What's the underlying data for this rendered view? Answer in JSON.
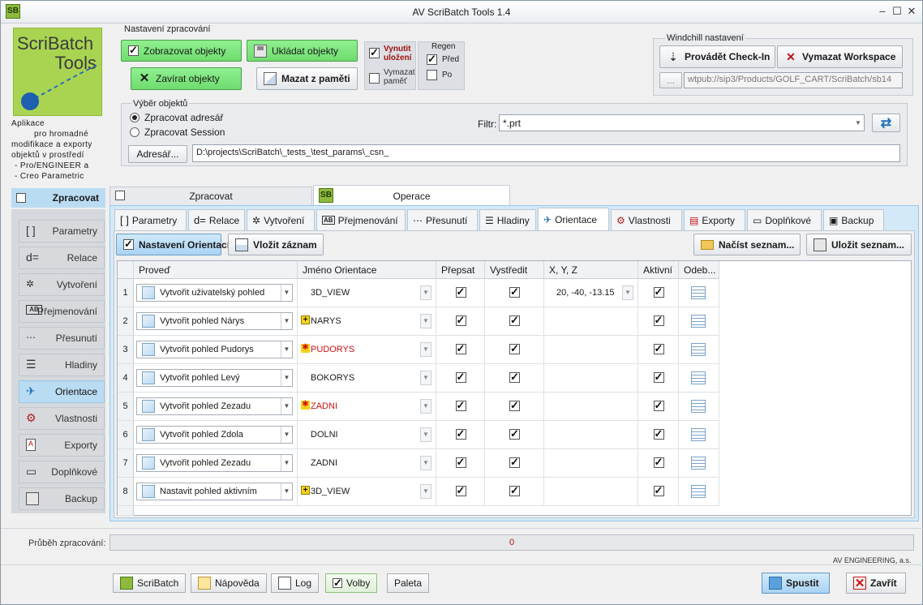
{
  "window": {
    "title": "AV ScriBatch Tools 1.4",
    "app_badge": "SB"
  },
  "logo": {
    "line1": "ScriBatch",
    "line2": "Tools"
  },
  "about": {
    "line1": "Aplikace",
    "line2": "pro hromadné",
    "line3": "modifikace a exporty",
    "line4": "objektů v prostředí",
    "line5": "- Pro/ENGINEER a",
    "line6": "- Creo Parametric"
  },
  "processing_settings": {
    "label": "Nastavení zpracování",
    "show_objects": "Zobrazovat objekty",
    "save_objects": "Ukládat objekty",
    "close_objects": "Zavírat objekty",
    "clear_memory": "Mazat z paměti",
    "force_save_line1": "Vynutit",
    "force_save_line2": "uložení",
    "erase_memory_line1": "Vymazat",
    "erase_memory_line2": "paměť",
    "regen_label": "Regen",
    "regen_before": "Před",
    "regen_after": "Po"
  },
  "windchill": {
    "label": "Windchill nastavení",
    "checkin": "Provádět Check-In",
    "clear_workspace": "Vymazat Workspace",
    "browse": "...",
    "workspace_path": "wtpub://sip3/Products/GOLF_CART/ScriBatch/sb14"
  },
  "object_selection": {
    "label": "Výběr objektů",
    "process_directory": "Zpracovat adresář",
    "process_session": "Zpracovat Session",
    "filter_label": "Filtr:",
    "filter_value": "*.prt",
    "directory_button": "Adresář...",
    "directory_path": "D:\\projects\\ScriBatch\\_tests_\\test_params\\_csn_"
  },
  "sidebar": {
    "header": "Zpracovat",
    "items": [
      {
        "label": "Parametry",
        "icon": "brackets-icon"
      },
      {
        "label": "Relace",
        "icon": "relation-icon"
      },
      {
        "label": "Vytvoření",
        "icon": "create-icon"
      },
      {
        "label": "Přejmenování",
        "icon": "rename-icon"
      },
      {
        "label": "Přesunutí",
        "icon": "move-icon"
      },
      {
        "label": "Hladiny",
        "icon": "layers-icon"
      },
      {
        "label": "Orientace",
        "icon": "orientation-icon"
      },
      {
        "label": "Vlastnosti",
        "icon": "properties-icon"
      },
      {
        "label": "Exporty",
        "icon": "pdf-icon"
      },
      {
        "label": "Doplňkové",
        "icon": "addons-icon"
      },
      {
        "label": "Backup",
        "icon": "disk-icon"
      }
    ]
  },
  "main_tabs": [
    {
      "label": "Zpracovat"
    },
    {
      "label": "Operace"
    }
  ],
  "sub_tabs": [
    {
      "label": "Parametry"
    },
    {
      "label": "Relace"
    },
    {
      "label": "Vytvoření"
    },
    {
      "label": "Přejmenování"
    },
    {
      "label": "Přesunutí"
    },
    {
      "label": "Hladiny"
    },
    {
      "label": "Orientace"
    },
    {
      "label": "Vlastnosti"
    },
    {
      "label": "Exporty"
    },
    {
      "label": "Doplňkové"
    },
    {
      "label": "Backup"
    }
  ],
  "orientation_toolbar": {
    "settings": "Nastavení Orientací",
    "insert": "Vložit záznam",
    "load_list": "Načíst seznam...",
    "save_list": "Uložit seznam..."
  },
  "grid": {
    "columns": [
      "Proveď",
      "Jméno Orientace",
      "Přepsat",
      "Vystředit",
      "X, Y, Z",
      "Aktivní",
      "Odeb..."
    ],
    "rows": [
      {
        "num": "1",
        "action": "Vytvořit uživatelský pohled",
        "name": "3D_VIEW",
        "name_color": "#1a1a1a",
        "marker": "",
        "overwrite": true,
        "center": true,
        "xyz": "20, -40, -13.15",
        "active": true
      },
      {
        "num": "2",
        "action": "Vytvořit pohled Nárys",
        "name": "NARYS",
        "name_color": "#1a1a1a",
        "marker": "plus",
        "overwrite": true,
        "center": true,
        "xyz": "",
        "active": true
      },
      {
        "num": "3",
        "action": "Vytvořit pohled Pudorys",
        "name": "PUDORYS",
        "name_color": "#d01010",
        "marker": "star",
        "overwrite": true,
        "center": true,
        "xyz": "",
        "active": true
      },
      {
        "num": "4",
        "action": "Vytvořit pohled Levý",
        "name": "BOKORYS",
        "name_color": "#1a1a1a",
        "marker": "",
        "overwrite": true,
        "center": true,
        "xyz": "",
        "active": true
      },
      {
        "num": "5",
        "action": "Vytvořit pohled Zezadu",
        "name": "ZADNI",
        "name_color": "#d01010",
        "marker": "star",
        "overwrite": true,
        "center": true,
        "xyz": "",
        "active": true
      },
      {
        "num": "6",
        "action": "Vytvořit pohled Zdola",
        "name": "DOLNI",
        "name_color": "#1a1a1a",
        "marker": "",
        "overwrite": true,
        "center": true,
        "xyz": "",
        "active": true
      },
      {
        "num": "7",
        "action": "Vytvořit pohled Zezadu",
        "name": "ZADNI",
        "name_color": "#1a1a1a",
        "marker": "",
        "overwrite": true,
        "center": true,
        "xyz": "",
        "active": true
      },
      {
        "num": "8",
        "action": "Nastavit pohled aktivním",
        "name": "3D_VIEW",
        "name_color": "#1a1a1a",
        "marker": "plus",
        "overwrite": true,
        "center": true,
        "xyz": "",
        "active": true
      }
    ]
  },
  "progress": {
    "label": "Průběh zpracování:",
    "value": "0",
    "fraction": 0
  },
  "company": "AV ENGINEERING, a.s.",
  "footer": {
    "scribatch": "ScriBatch",
    "help": "Nápověda",
    "log": "Log",
    "options": "Volby",
    "palette": "Paleta",
    "run": "Spustit",
    "close": "Zavřít"
  },
  "colors": {
    "accent": "#b9dcf3",
    "green": "#6fdc6f",
    "tab_bg": "#d3e9f8"
  }
}
